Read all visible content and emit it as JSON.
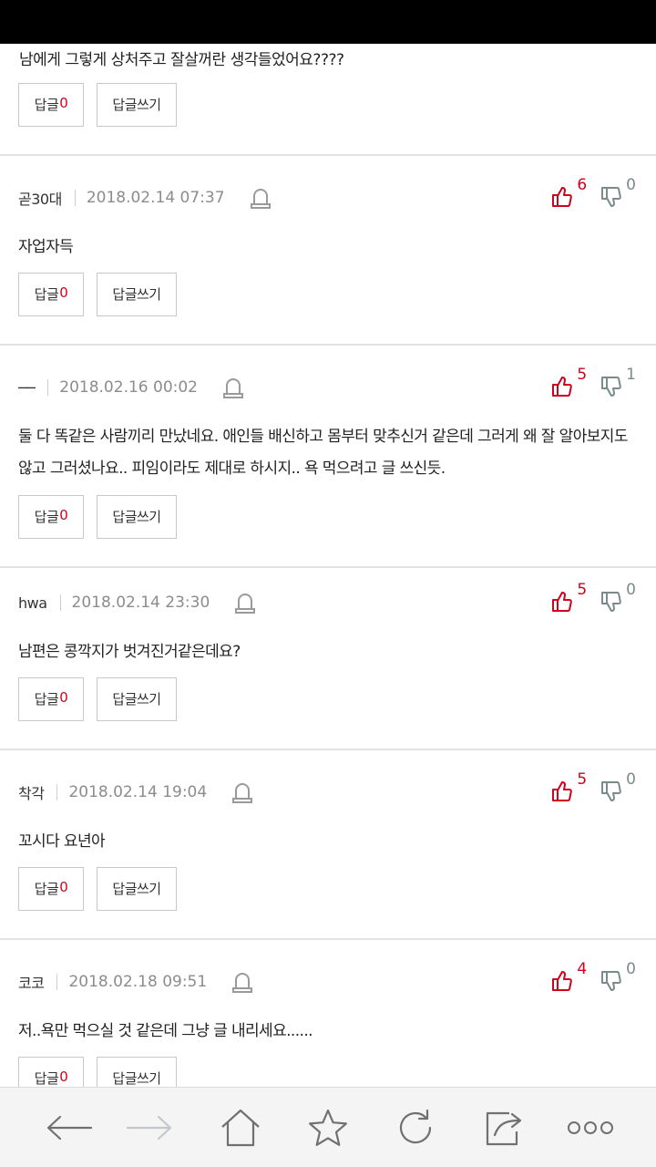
{
  "first_comment": {
    "text": "남에게 그렇게 상처주고 잘살꺼란 생각들었어요????",
    "reply_label": "답글",
    "reply_count": "0",
    "write_label": "답글쓰기"
  },
  "comments": [
    {
      "author": "곧30대",
      "date": "2018.02.14 07:37",
      "up": "6",
      "down": "0",
      "text": "자업자득",
      "reply_label": "답글",
      "reply_count": "0",
      "write_label": "답글쓰기"
    },
    {
      "author": "──",
      "date": "2018.02.16 00:02",
      "up": "5",
      "down": "1",
      "text": "둘 다 똑같은 사람끼리 만났네요. 애인들 배신하고 몸부터 맞추신거 같은데 그러게 왜 잘 알아보지도 않고 그러셨나요.. 피임이라도 제대로 하시지.. 욕 먹으려고 글 쓰신듯.",
      "reply_label": "답글",
      "reply_count": "0",
      "write_label": "답글쓰기"
    },
    {
      "author": "hwa",
      "date": "2018.02.14 23:30",
      "up": "5",
      "down": "0",
      "text": "남편은 콩깍지가 벗겨진거같은데요?",
      "reply_label": "답글",
      "reply_count": "0",
      "write_label": "답글쓰기"
    },
    {
      "author": "착각",
      "date": "2018.02.14 19:04",
      "up": "5",
      "down": "0",
      "text": "꼬시다 요년아",
      "reply_label": "답글",
      "reply_count": "0",
      "write_label": "답글쓰기"
    },
    {
      "author": "코코",
      "date": "2018.02.18 09:51",
      "up": "4",
      "down": "0",
      "text": "저..욕만 먹으실 것 같은데 그냥 글 내리세요......",
      "reply_label": "답글",
      "reply_count": "0",
      "write_label": "답글쓰기"
    }
  ],
  "colors": {
    "accent_red": "#d0021b",
    "muted_gray": "#8c8c8c",
    "down_gray": "#7a8b8c",
    "toolbar_bg": "#f4f4f5"
  },
  "toolbar": {
    "back": "back-arrow-icon",
    "forward": "forward-arrow-icon",
    "home": "home-icon",
    "bookmark": "star-icon",
    "refresh": "refresh-icon",
    "share": "share-icon",
    "more": "more-icon"
  }
}
